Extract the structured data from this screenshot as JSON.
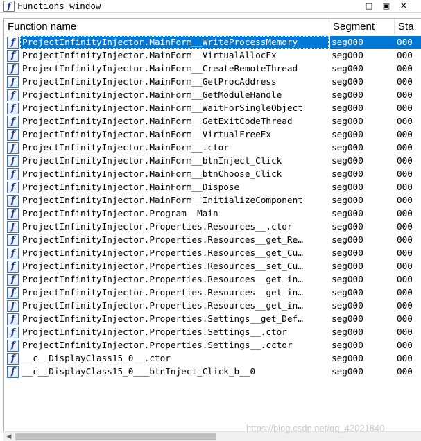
{
  "window": {
    "icon_glyph": "f",
    "title": "Functions window",
    "restore_glyph": "□",
    "maximize_glyph": "▣",
    "close_glyph": "×"
  },
  "columns": {
    "name": "Function name",
    "segment": "Segment",
    "start": "Sta"
  },
  "functions": [
    {
      "name": "ProjectInfinityInjector.MainForm__WriteProcessMemory",
      "segment": "seg000",
      "start": "000",
      "selected": true
    },
    {
      "name": "ProjectInfinityInjector.MainForm__VirtualAllocEx",
      "segment": "seg000",
      "start": "000"
    },
    {
      "name": "ProjectInfinityInjector.MainForm__CreateRemoteThread",
      "segment": "seg000",
      "start": "000"
    },
    {
      "name": "ProjectInfinityInjector.MainForm__GetProcAddress",
      "segment": "seg000",
      "start": "000"
    },
    {
      "name": "ProjectInfinityInjector.MainForm__GetModuleHandle",
      "segment": "seg000",
      "start": "000"
    },
    {
      "name": "ProjectInfinityInjector.MainForm__WaitForSingleObject",
      "segment": "seg000",
      "start": "000"
    },
    {
      "name": "ProjectInfinityInjector.MainForm__GetExitCodeThread",
      "segment": "seg000",
      "start": "000"
    },
    {
      "name": "ProjectInfinityInjector.MainForm__VirtualFreeEx",
      "segment": "seg000",
      "start": "000"
    },
    {
      "name": "ProjectInfinityInjector.MainForm__.ctor",
      "segment": "seg000",
      "start": "000"
    },
    {
      "name": "ProjectInfinityInjector.MainForm__btnInject_Click",
      "segment": "seg000",
      "start": "000"
    },
    {
      "name": "ProjectInfinityInjector.MainForm__btnChoose_Click",
      "segment": "seg000",
      "start": "000"
    },
    {
      "name": "ProjectInfinityInjector.MainForm__Dispose",
      "segment": "seg000",
      "start": "000"
    },
    {
      "name": "ProjectInfinityInjector.MainForm__InitializeComponent",
      "segment": "seg000",
      "start": "000"
    },
    {
      "name": "ProjectInfinityInjector.Program__Main",
      "segment": "seg000",
      "start": "000"
    },
    {
      "name": "ProjectInfinityInjector.Properties.Resources__.ctor",
      "segment": "seg000",
      "start": "000"
    },
    {
      "name": "ProjectInfinityInjector.Properties.Resources__get_Re…",
      "segment": "seg000",
      "start": "000"
    },
    {
      "name": "ProjectInfinityInjector.Properties.Resources__get_Cu…",
      "segment": "seg000",
      "start": "000"
    },
    {
      "name": "ProjectInfinityInjector.Properties.Resources__set_Cu…",
      "segment": "seg000",
      "start": "000"
    },
    {
      "name": "ProjectInfinityInjector.Properties.Resources__get_in…",
      "segment": "seg000",
      "start": "000"
    },
    {
      "name": "ProjectInfinityInjector.Properties.Resources__get_in…",
      "segment": "seg000",
      "start": "000"
    },
    {
      "name": "ProjectInfinityInjector.Properties.Resources__get_in…",
      "segment": "seg000",
      "start": "000"
    },
    {
      "name": "ProjectInfinityInjector.Properties.Settings__get_Def…",
      "segment": "seg000",
      "start": "000"
    },
    {
      "name": "ProjectInfinityInjector.Properties.Settings__.ctor",
      "segment": "seg000",
      "start": "000"
    },
    {
      "name": "ProjectInfinityInjector.Properties.Settings__.cctor",
      "segment": "seg000",
      "start": "000"
    },
    {
      "name": "__c__DisplayClass15_0__.ctor",
      "segment": "seg000",
      "start": "000"
    },
    {
      "name": "__c__DisplayClass15_0___btnInject_Click_b__0",
      "segment": "seg000",
      "start": "000"
    }
  ],
  "function_icon_glyph": "f",
  "scrollbar": {
    "left_arrow_glyph": "◀",
    "position_fraction": 0.0
  },
  "watermark": "https://blog.csdn.net/qq_42021840"
}
